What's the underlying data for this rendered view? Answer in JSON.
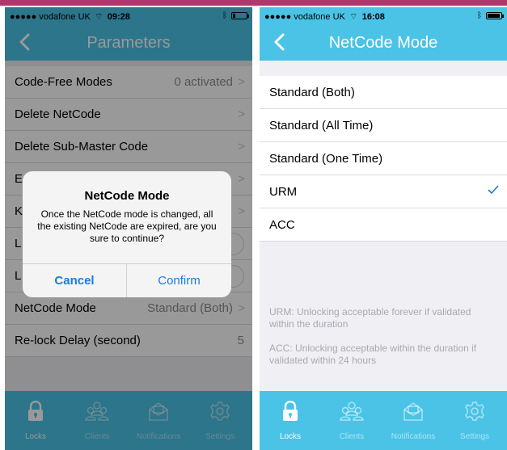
{
  "colors": {
    "accent": "#4ac3e6",
    "link": "#1a7bd9",
    "top_strip": "#b0376e"
  },
  "left": {
    "status": {
      "carrier": "●●●●● vodafone UK",
      "wifi_icon": "wifi-icon",
      "time": "09:28",
      "bluetooth_icon": "bluetooth-icon",
      "battery_level": 0.15
    },
    "nav": {
      "title": "Parameters",
      "back_icon": "chevron-left-icon"
    },
    "rows": [
      {
        "label": "Code-Free Modes",
        "value": "0 activated",
        "accessory": "chevron"
      },
      {
        "label": "Delete NetCode",
        "value": "",
        "accessory": "chevron"
      },
      {
        "label": "Delete Sub-Master Code",
        "value": "",
        "accessory": "chevron"
      },
      {
        "label": "E",
        "value": "",
        "accessory": "chevron"
      },
      {
        "label": "K",
        "value": "",
        "accessory": "chevron"
      },
      {
        "label": "L",
        "value": "",
        "accessory": "toggle"
      },
      {
        "label": "L",
        "value": "",
        "accessory": "toggle"
      },
      {
        "label": "NetCode Mode",
        "value": "Standard (Both)",
        "accessory": "chevron"
      },
      {
        "label": "Re-lock Delay (second)",
        "value": "5",
        "accessory": "none"
      }
    ],
    "alert": {
      "title": "NetCode Mode",
      "message": "Once the NetCode mode is changed, all the existing NetCode are expired, are you sure to continue?",
      "cancel_label": "Cancel",
      "confirm_label": "Confirm"
    },
    "tabs": [
      {
        "label": "Locks",
        "icon": "lock-icon",
        "active": true
      },
      {
        "label": "Clients",
        "icon": "users-icon",
        "active": false
      },
      {
        "label": "Notifications",
        "icon": "envelope-icon",
        "active": false
      },
      {
        "label": "Settings",
        "icon": "gear-icon",
        "active": false
      }
    ]
  },
  "right": {
    "status": {
      "carrier": "●●●●● vodafone UK",
      "wifi_icon": "wifi-icon",
      "time": "16:08",
      "bluetooth_icon": "bluetooth-icon",
      "battery_level": 0.85
    },
    "nav": {
      "title": "NetCode Mode",
      "back_icon": "chevron-left-icon"
    },
    "options": [
      {
        "label": "Standard (Both)",
        "selected": false
      },
      {
        "label": "Standard (All Time)",
        "selected": false
      },
      {
        "label": "Standard (One Time)",
        "selected": false
      },
      {
        "label": "URM",
        "selected": true
      },
      {
        "label": "ACC",
        "selected": false
      }
    ],
    "notes": [
      "URM: Unlocking acceptable forever if validated within the duration",
      "ACC: Unlocking acceptable within the duration if validated within 24 hours"
    ],
    "tabs": [
      {
        "label": "Locks",
        "icon": "lock-icon",
        "active": true
      },
      {
        "label": "Clients",
        "icon": "users-icon",
        "active": false
      },
      {
        "label": "Notifications",
        "icon": "envelope-icon",
        "active": false
      },
      {
        "label": "Settings",
        "icon": "gear-icon",
        "active": false
      }
    ]
  }
}
